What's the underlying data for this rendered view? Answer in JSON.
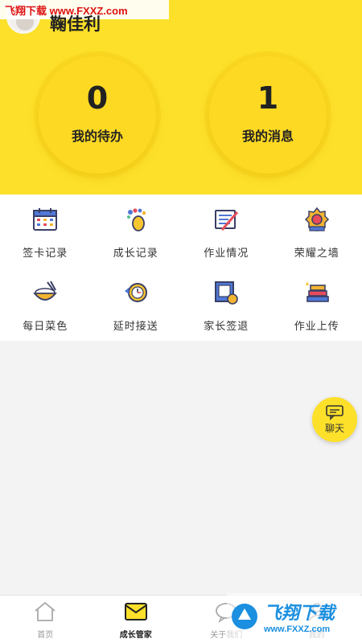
{
  "watermark_top": {
    "text": "飞翔下载 www.FXXZ.com"
  },
  "header": {
    "username": "鞠佳利",
    "todo": {
      "count": "0",
      "label": "我的待办"
    },
    "messages": {
      "count": "1",
      "label": "我的消息"
    },
    "accent": "#fde02a"
  },
  "grid": {
    "items": [
      {
        "label": "签卡记录",
        "icon": "calendar-icon"
      },
      {
        "label": "成长记录",
        "icon": "footprint-icon"
      },
      {
        "label": "作业情况",
        "icon": "homework-icon"
      },
      {
        "label": "荣耀之墙",
        "icon": "medal-icon"
      },
      {
        "label": "每日菜色",
        "icon": "rice-bowl-icon"
      },
      {
        "label": "延时接送",
        "icon": "clock-icon"
      },
      {
        "label": "家长签退",
        "icon": "signout-icon"
      },
      {
        "label": "作业上传",
        "icon": "books-icon"
      }
    ]
  },
  "fab": {
    "label": "聊天",
    "icon": "chat-icon"
  },
  "bottom_nav": {
    "items": [
      {
        "label": "首页",
        "icon": "home-icon"
      },
      {
        "label": "成长管家",
        "icon": "mail-icon",
        "active": true
      },
      {
        "label": "关于我们",
        "icon": "chat-bubble-icon"
      },
      {
        "label": "我的",
        "icon": "user-icon"
      }
    ]
  },
  "watermark_br": {
    "title": "飞翔下载",
    "url": "www.FXXZ.com"
  }
}
